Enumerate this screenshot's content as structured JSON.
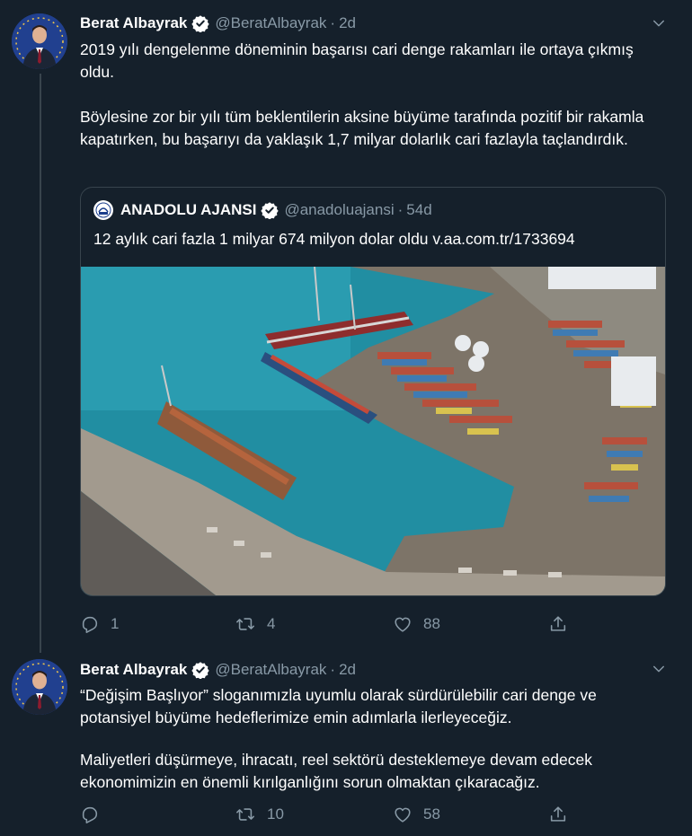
{
  "tweets": [
    {
      "name": "Berat Albayrak",
      "handle": "@BeratAlbayrak",
      "separator": "·",
      "time": "2d",
      "paragraphs": [
        "2019 yılı dengelenme döneminin başarısı cari denge rakamları ile ortaya çıkmış oldu.",
        "Böylesine zor bir yılı tüm beklentilerin aksine büyüme tarafında pozitif bir rakamla kapatırken, bu başarıyı da yaklaşık 1,7 milyar dolarlık cari fazlayla taçlandırdık."
      ],
      "quote": {
        "name": "ANADOLU AJANSI",
        "handle": "@anadoluajansi",
        "separator": "·",
        "time": "54d",
        "text": "12 aylık cari fazla 1 milyar 674 milyon dolar oldu v.aa.com.tr/1733694"
      },
      "replies": "1",
      "retweets": "4",
      "likes": "88"
    },
    {
      "name": "Berat Albayrak",
      "handle": "@BeratAlbayrak",
      "separator": "·",
      "time": "2d",
      "paragraphs": [
        "“Değişim Başlıyor” sloganımızla uyumlu olarak sürdürülebilir cari denge ve potansiyel büyüme hedeflerimize emin adımlarla ilerleyeceğiz.",
        "Maliyetleri düşürmeye, ihracatı, reel sektörü desteklemeye devam edecek ekonomimizin en önemli kırılganlığını sorun olmaktan çıkaracağız."
      ],
      "replies": "",
      "retweets": "10",
      "likes": "58"
    }
  ],
  "colors": {
    "background": "#15202b",
    "secondary_text": "#8899a6",
    "border": "#38444d",
    "verified": "#ffffff"
  },
  "icons": [
    "verified-badge-icon",
    "chevron-down-icon",
    "reply-icon",
    "retweet-icon",
    "like-icon",
    "share-icon"
  ]
}
